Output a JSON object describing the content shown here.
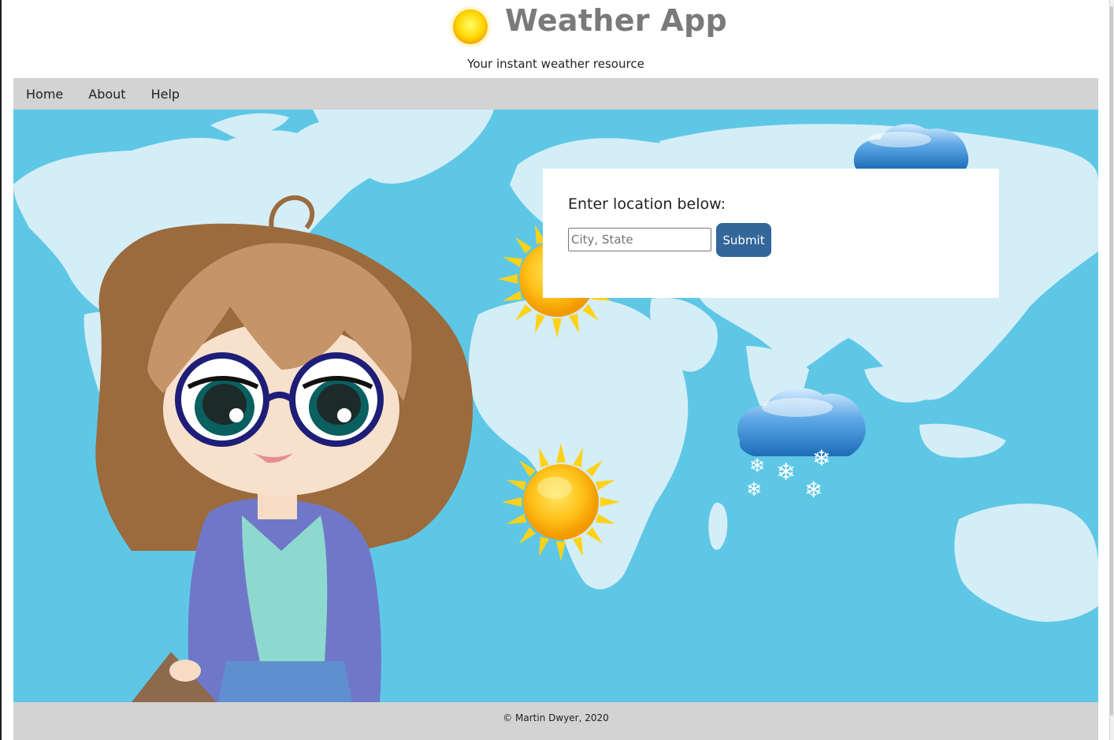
{
  "header": {
    "title": "Weather App",
    "subtitle": "Your instant weather resource",
    "logo_icon": "sun-icon"
  },
  "nav": {
    "items": [
      {
        "label": "Home"
      },
      {
        "label": "About"
      },
      {
        "label": "Help"
      }
    ]
  },
  "hero": {
    "background_color": "#5ec7e6",
    "landmass_color": "#d4eef7",
    "illustration": "cartoon-girl-with-glasses",
    "weather_icons": [
      "cloud-icon",
      "sun-icon",
      "sun-icon",
      "snow-cloud-icon"
    ]
  },
  "location_form": {
    "heading": "Enter location below:",
    "input_value": "",
    "input_placeholder": "City, State",
    "submit_label": "Submit",
    "submit_color": "#336699"
  },
  "footer": {
    "text": "© Martin Dwyer, 2020"
  }
}
